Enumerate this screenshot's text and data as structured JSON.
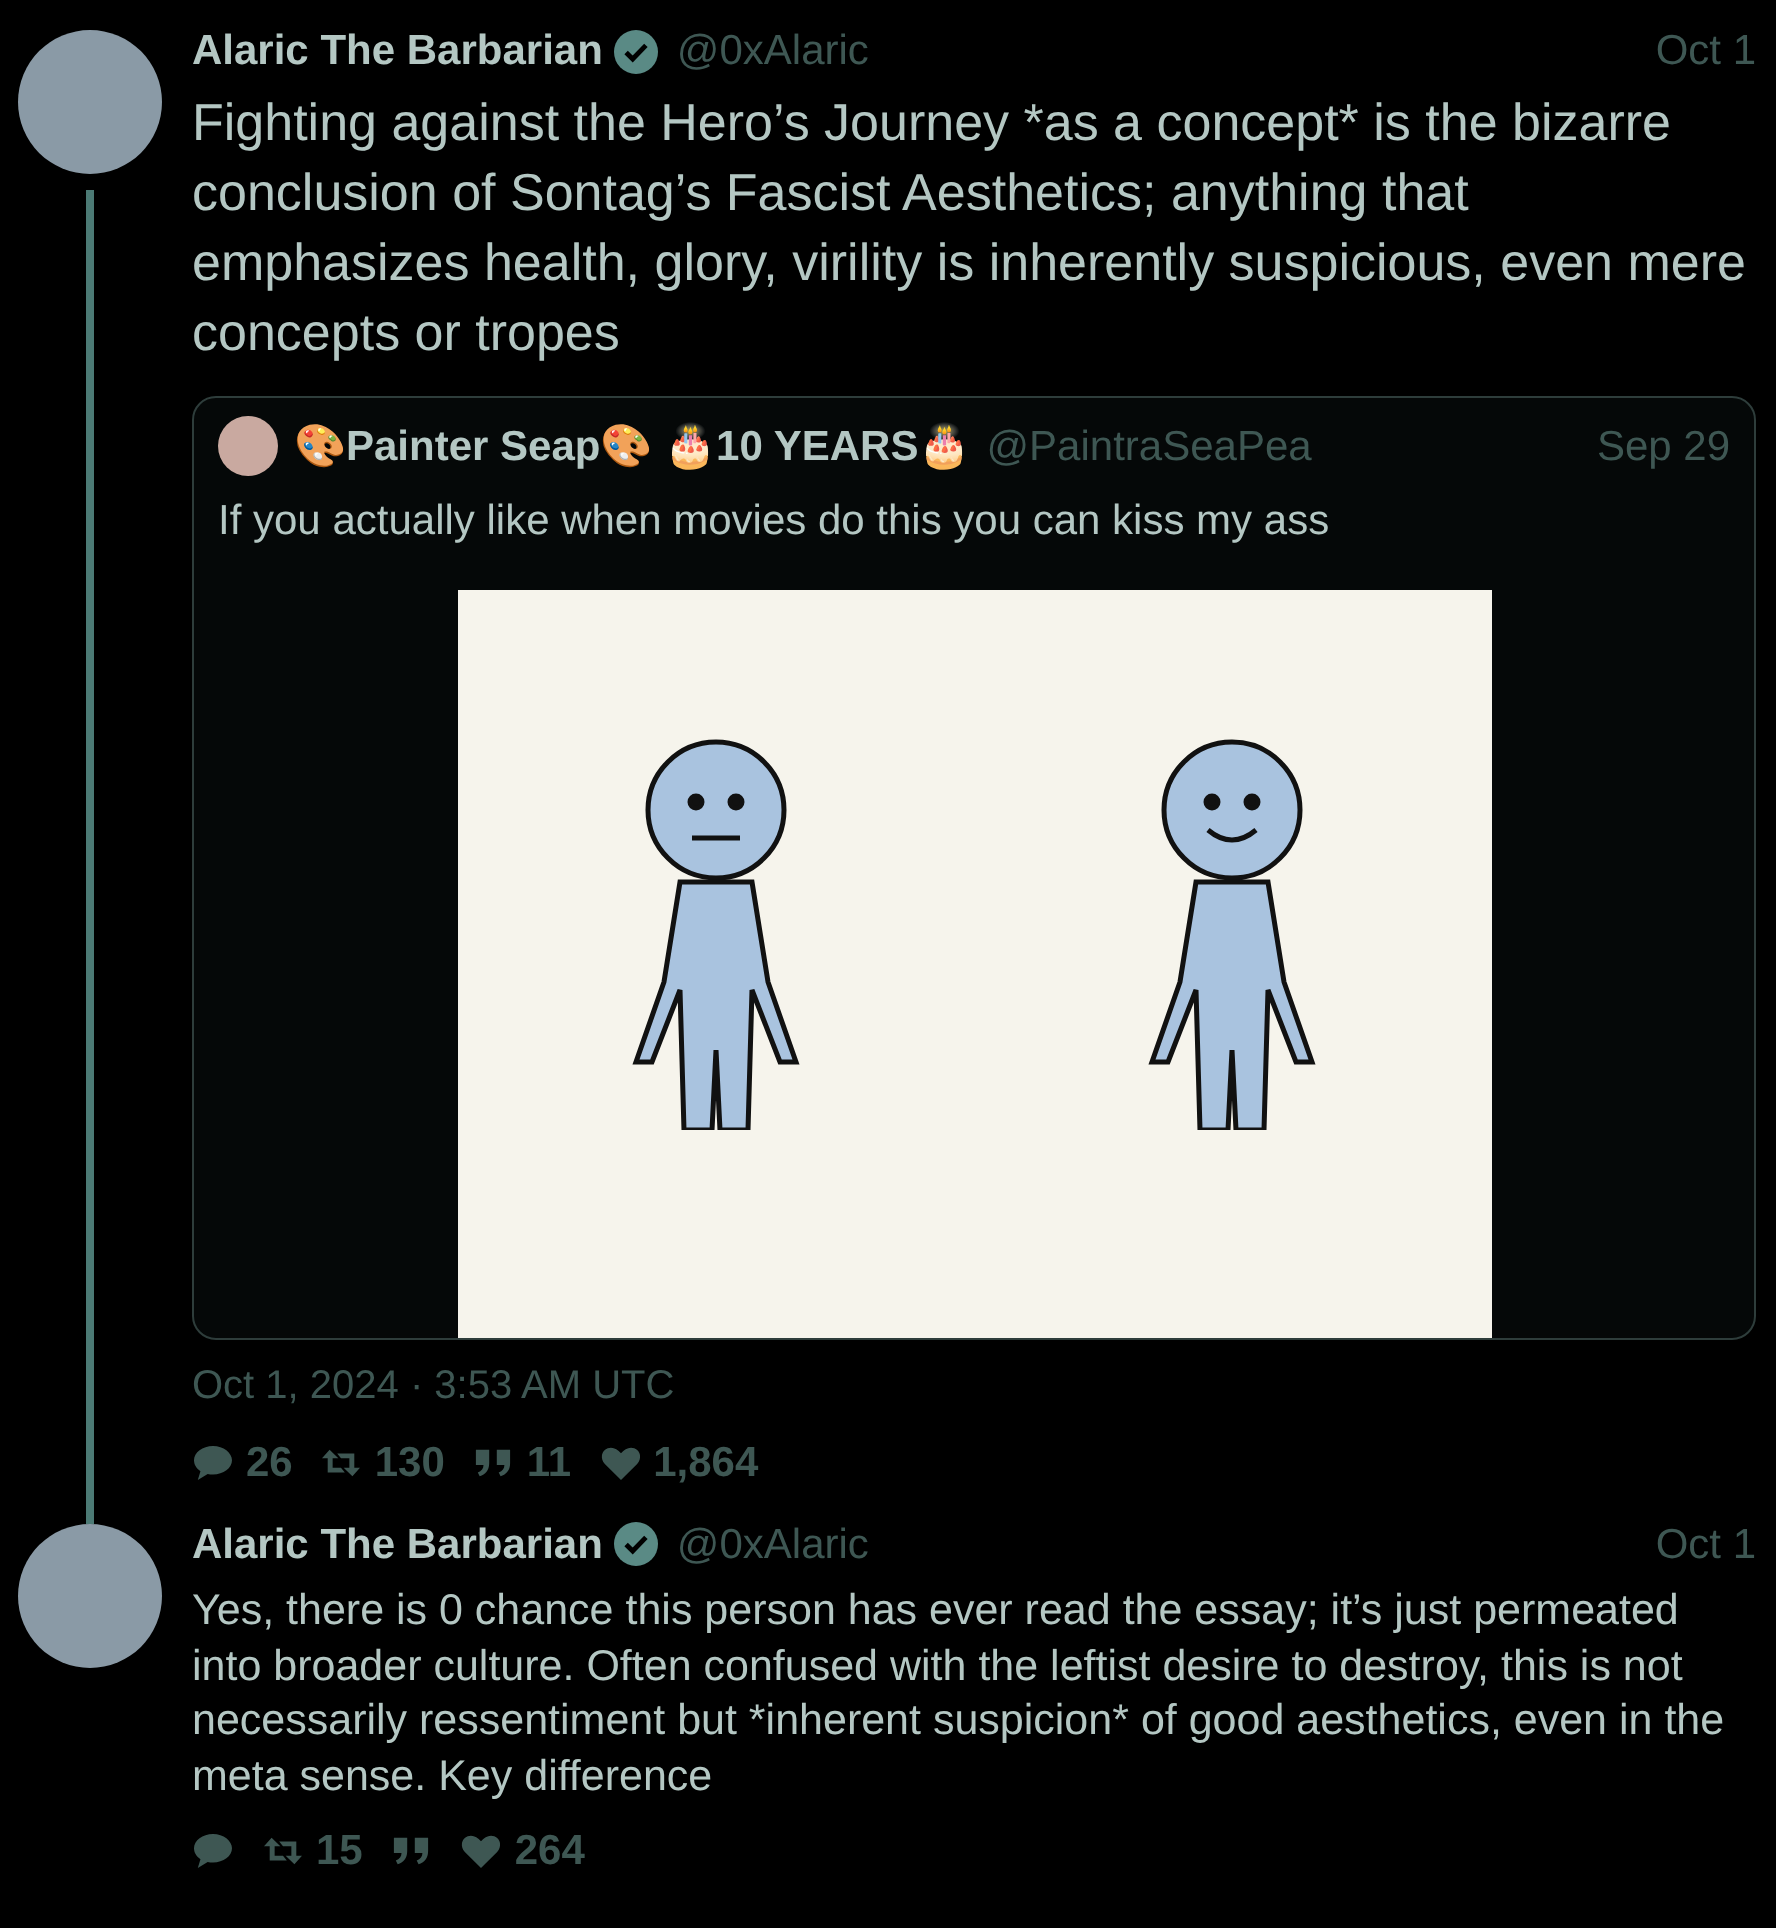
{
  "tweets": [
    {
      "author": {
        "name": "Alaric The Barbarian",
        "verified": true,
        "handle": "@0xAlaric"
      },
      "date": "Oct 1",
      "text": "Fighting against the Hero’s Journey *as a concept* is the bizarre conclusion of Sontag’s Fascist Aesthetics; anything that emphasizes health, glory, virility is inherently suspicious, even mere concepts or tropes",
      "large": true,
      "thread_continues": true,
      "quote": {
        "author": {
          "name": "🎨Painter Seap🎨 🎂10 YEARS🎂",
          "handle": "@PaintraSeaPea"
        },
        "date": "Sep 29",
        "text": "If you actually like when movies do this you can kiss my ass",
        "has_image": true
      },
      "timestamp": "Oct 1, 2024 · 3:53 AM UTC",
      "stats": [
        {
          "kind": "replies",
          "count": "26"
        },
        {
          "kind": "retweets",
          "count": "130"
        },
        {
          "kind": "quotes",
          "count": "11"
        },
        {
          "kind": "likes",
          "count": "1,864"
        }
      ]
    },
    {
      "author": {
        "name": "Alaric The Barbarian",
        "verified": true,
        "handle": "@0xAlaric"
      },
      "date": "Oct 1",
      "text": "Yes, there is 0 chance this person has ever read the essay; it’s just permeated into broader culture. Often confused with the leftist desire to destroy, this is not necessarily ressentiment but *inherent suspicion* of good aesthetics, even in the meta sense. Key difference",
      "large": false,
      "thread_continues": false,
      "stats": [
        {
          "kind": "replies"
        },
        {
          "kind": "retweets",
          "count": "15"
        },
        {
          "kind": "quotes"
        },
        {
          "kind": "likes",
          "count": "264"
        }
      ]
    }
  ]
}
